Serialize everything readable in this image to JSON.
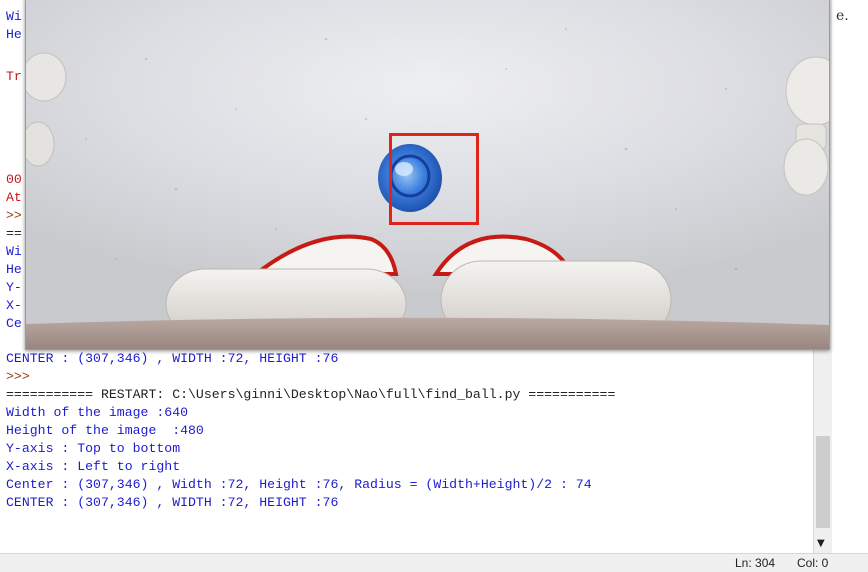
{
  "console": {
    "hidden_left": [
      "Wi",
      "He",
      "",
      "Tr",
      "",
      "",
      "",
      "",
      "",
      "00",
      "At",
      ">>",
      "==",
      "Wi",
      "He",
      "Y-",
      "X-",
      "Ce"
    ],
    "lines": [
      {
        "text": "CENTER : (307,346) , WIDTH :72, HEIGHT :76",
        "kind": "output"
      },
      {
        "text": ">>>",
        "kind": "prompt"
      },
      {
        "text": "=========== RESTART: C:\\Users\\ginni\\Desktop\\Nao\\full\\find_ball.py ===========",
        "kind": "restart"
      },
      {
        "text": "Width of the image :640",
        "kind": "output"
      },
      {
        "text": "Height of the image  :480",
        "kind": "output"
      },
      {
        "text": "Y-axis : Top to bottom",
        "kind": "output"
      },
      {
        "text": "X-axis : Left to right",
        "kind": "output"
      },
      {
        "text": "Center : (307,346) , Width :72, Height :76, Radius = (Width+Height)/2 : 74",
        "kind": "output"
      },
      {
        "text": "CENTER : (307,346) , WIDTH :72, HEIGHT :76",
        "kind": "output"
      }
    ]
  },
  "edge_text": "e.",
  "statusbar": {
    "ln": "Ln: 304",
    "col": "Col: 0"
  },
  "scrollbar": {
    "down_arrow": "▼"
  },
  "colors": {
    "output": "#1c1cd0",
    "error": "#c8141e",
    "prompt": "#9b3a17",
    "detection_box": "#e0241c",
    "ball": "#2f6fd0"
  }
}
